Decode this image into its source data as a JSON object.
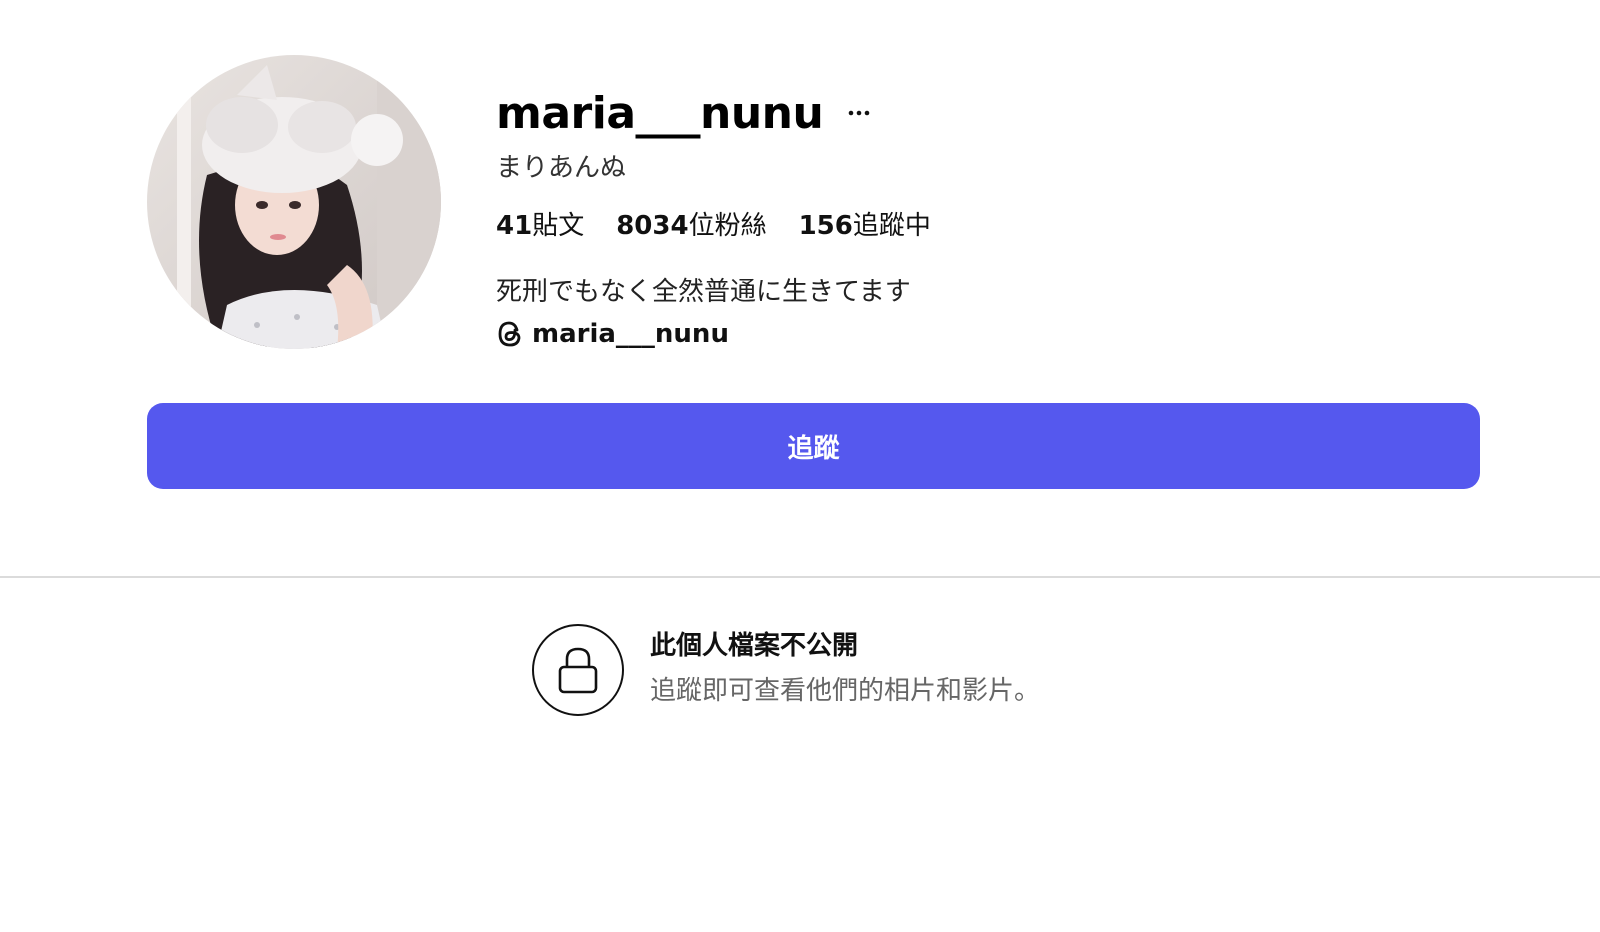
{
  "profile": {
    "username": "maria___nunu",
    "display_name": "まりあんぬ",
    "stats": {
      "posts": {
        "count": "41",
        "label": "貼文"
      },
      "followers": {
        "count": "8034",
        "label": "位粉絲"
      },
      "following": {
        "count": "156",
        "label": "追蹤中"
      }
    },
    "bio": "死刑でもなく全然普通に生きてます",
    "threads_handle": "maria___nunu"
  },
  "actions": {
    "more_label": "···",
    "follow_label": "追蹤"
  },
  "private_notice": {
    "title": "此個人檔案不公開",
    "subtitle": "追蹤即可查看他們的相片和影片。"
  },
  "icons": {
    "more": "more-options-icon",
    "threads": "threads-icon",
    "lock": "lock-icon"
  },
  "colors": {
    "follow_button": "#5558ee",
    "divider": "#dbdbdb",
    "subtitle_text": "#666666"
  }
}
